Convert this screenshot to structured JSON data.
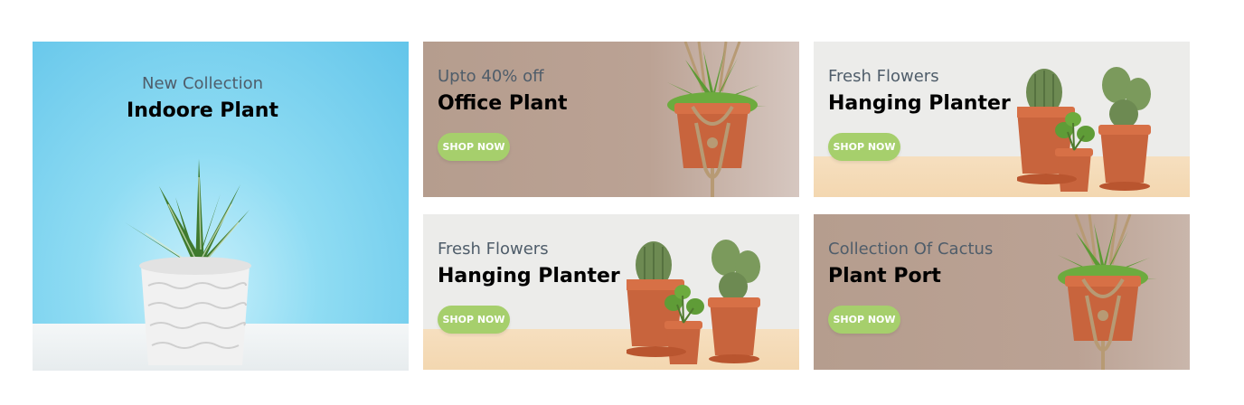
{
  "banners": {
    "main": {
      "eyebrow": "New Collection",
      "title": "Indoore Plant"
    },
    "office": {
      "eyebrow": "Upto 40% off",
      "title": "Office Plant",
      "button": "SHOP NOW"
    },
    "fresh1": {
      "eyebrow": "Fresh Flowers",
      "title": "Hanging Planter",
      "button": "SHOP NOW"
    },
    "fresh2": {
      "eyebrow": "Fresh Flowers",
      "title": "Hanging Planter",
      "button": "SHOP NOW"
    },
    "cactus": {
      "eyebrow": "Collection Of Cactus",
      "title": "Plant Port",
      "button": "SHOP NOW"
    }
  },
  "colors": {
    "button": "#a6cf6c",
    "brown_banner": "#b59d8e",
    "light_banner": "#ececea",
    "sky_banner": "#63c5ea"
  },
  "icons": [
    "succulent-pot-image",
    "hanging-planter-image",
    "cactus-pots-image"
  ]
}
